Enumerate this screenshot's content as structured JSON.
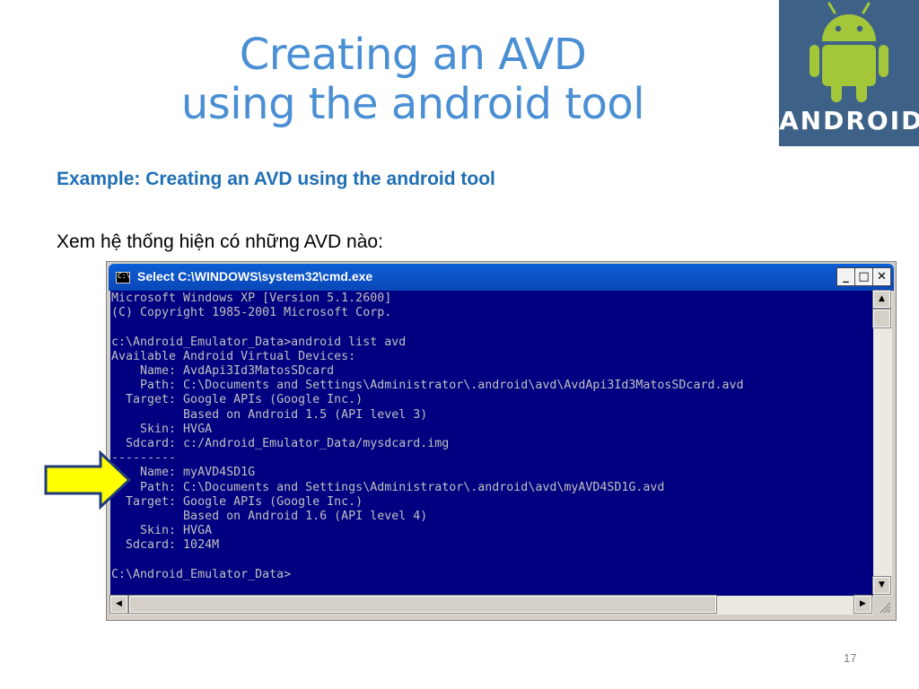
{
  "slide": {
    "title_line1": "Creating an AVD",
    "title_line2": "using the android tool",
    "subtitle": "Example: Creating an AVD using the android tool",
    "body_text": "Xem hệ thống hiện có những AVD nào:",
    "page_number": "17"
  },
  "logo": {
    "text": "ANDROID",
    "background_color": "#3e6187",
    "robot_color": "#a4c639"
  },
  "window": {
    "title": "Select C:\\WINDOWS\\system32\\cmd.exe",
    "buttons": {
      "minimize": "_",
      "maximize": "□",
      "close": "✕"
    }
  },
  "console": {
    "lines": [
      "Microsoft Windows XP [Version 5.1.2600]",
      "(C) Copyright 1985-2001 Microsoft Corp.",
      "",
      "c:\\Android_Emulator_Data>android list avd",
      "Available Android Virtual Devices:",
      "    Name: AvdApi3Id3MatosSDcard",
      "    Path: C:\\Documents and Settings\\Administrator\\.android\\avd\\AvdApi3Id3MatosSDcard.avd",
      "  Target: Google APIs (Google Inc.)",
      "          Based on Android 1.5 (API level 3)",
      "    Skin: HVGA",
      "  Sdcard: c:/Android_Emulator_Data/mysdcard.img",
      "---------",
      "    Name: myAVD4SD1G",
      "    Path: C:\\Documents and Settings\\Administrator\\.android\\avd\\myAVD4SD1G.avd",
      "  Target: Google APIs (Google Inc.)",
      "          Based on Android 1.6 (API level 4)",
      "    Skin: HVGA",
      "  Sdcard: 1024M",
      "",
      "C:\\Android_Emulator_Data>"
    ],
    "text_color": "#c0c0c0",
    "background_color": "#000080"
  },
  "arrow": {
    "icon": "arrow-right-icon",
    "fill_color": "#ffff00"
  },
  "scrollbars": {
    "up": "▲",
    "down": "▼",
    "left": "◀",
    "right": "▶"
  }
}
